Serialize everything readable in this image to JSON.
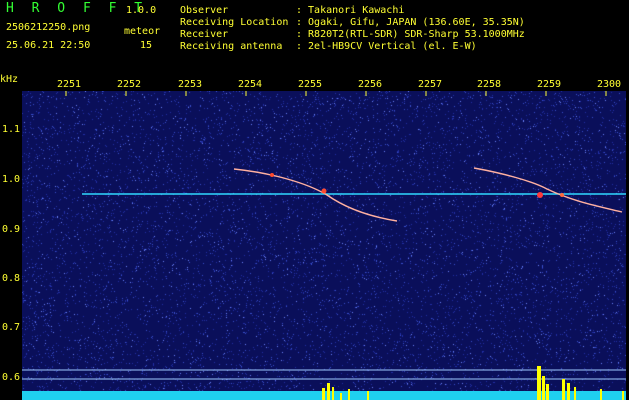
{
  "header": {
    "logo": "H R O F F T",
    "version": "1.0.0",
    "filename": "2506212250.png",
    "datetime": "25.06.21 22:50",
    "meteor_label": "meteor",
    "meteor_count": "15",
    "info": [
      {
        "label": "Observer",
        "value": ": Takanori Kawachi"
      },
      {
        "label": "Receiving Location",
        "value": ": Ogaki, Gifu, JAPAN (136.60E, 35.35N)"
      },
      {
        "label": "Receiver",
        "value": ": R820T2(RTL-SDR) SDR-Sharp 53.1000MHz"
      },
      {
        "label": "Receiving antenna",
        "value": ": 2el-HB9CV Vertical (el. E-W)"
      }
    ]
  },
  "axes": {
    "y_unit": "kHz",
    "y_ticks": [
      "1.1",
      "1.0",
      "0.9",
      "0.8",
      "0.7",
      "0.6"
    ],
    "x_ticks": [
      "2251",
      "2252",
      "2253",
      "2254",
      "2255",
      "2256",
      "2257",
      "2258",
      "2259",
      "2300"
    ]
  },
  "colors": {
    "background": "#0a0f5a",
    "label": "#ffff33",
    "title": "#33ff33",
    "carrier": "#2fd9ff",
    "meteor_trail": "#ff6a3d",
    "histogram": "#ffff00"
  }
}
